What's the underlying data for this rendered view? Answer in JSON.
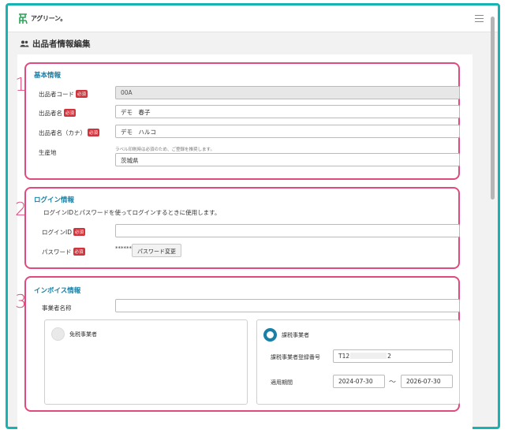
{
  "header": {
    "logo_text": "アグリーン。",
    "logo_icon": "sprout-logo-icon",
    "menu_icon": "hamburger-menu-icon"
  },
  "page": {
    "title": "出品者情報編集",
    "title_icon": "users-icon"
  },
  "colors": {
    "accent": "#1d7fa3",
    "highlight": "#e04a7e",
    "required": "#d0343c",
    "frame": "#17b3b3"
  },
  "badges": {
    "required": "必須"
  },
  "sections": {
    "basic": {
      "number": "1",
      "title": "基本情報",
      "seller_code": {
        "label": "出品者コード",
        "value": "00A"
      },
      "seller_name": {
        "label": "出品者名",
        "value": "デモ　春子"
      },
      "seller_name_kana": {
        "label": "出品者名（カナ）",
        "value": "デモ　ハルコ"
      },
      "origin": {
        "label": "生産地",
        "note": "ラベル印刷時は必須のため、ご登録を推奨します。",
        "value": "茨城県"
      }
    },
    "login": {
      "number": "2",
      "title": "ログイン情報",
      "description": "ログインIDとパスワードを使ってログインするときに使用します。",
      "login_id": {
        "label": "ログインID",
        "value": ""
      },
      "password": {
        "label": "パスワード",
        "masked": "******",
        "change_button": "パスワード変更"
      }
    },
    "invoice": {
      "number": "3",
      "title": "インボイス情報",
      "business_name": {
        "label": "事業者名称",
        "value": ""
      },
      "tax_exempt": {
        "label": "免税事業者",
        "selected": false
      },
      "taxable": {
        "label": "課税事業者",
        "selected": true,
        "reg_number_label": "課税事業者登録番号",
        "reg_number_prefix": "T12",
        "reg_number_suffix": "2",
        "period_label": "適用期間",
        "period_from": "2024-07-30",
        "period_separator": "〜",
        "period_to": "2026-07-30"
      }
    }
  }
}
